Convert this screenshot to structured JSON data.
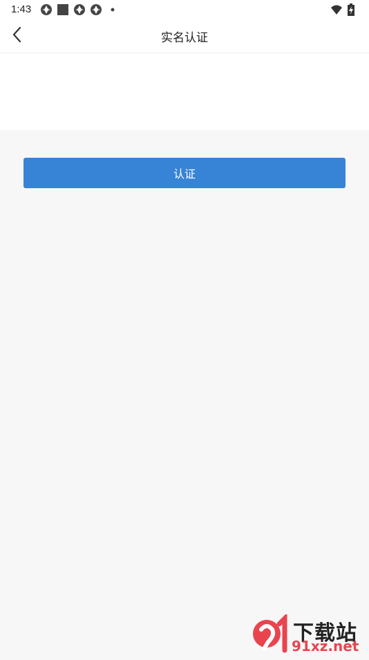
{
  "status_bar": {
    "time": "1:43",
    "left_icons": [
      "app-notification-icon",
      "square-notification-icon",
      "app-notification-icon",
      "app-notification-icon",
      "dot-icon"
    ],
    "right_icons": [
      "wifi-icon",
      "battery-charging-icon"
    ]
  },
  "header": {
    "title": "实名认证",
    "back_icon": "chevron-left-icon"
  },
  "main": {
    "submit_label": "认证",
    "button_color": "#3784d6"
  },
  "watermark": {
    "brand_top": "下载站",
    "brand_bottom": "91xz.net"
  }
}
